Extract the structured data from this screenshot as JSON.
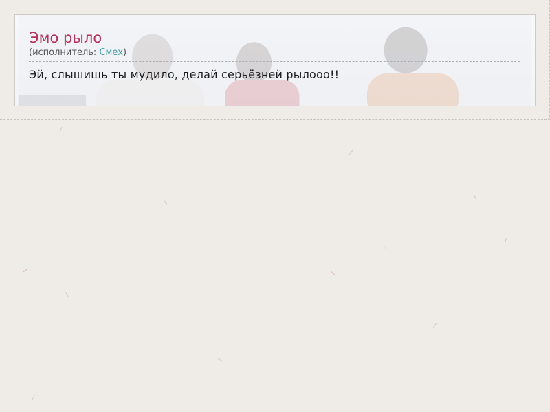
{
  "song": {
    "title": "Эмо рыло",
    "performer_prefix": "(исполнитель: ",
    "performer_name": "Смех",
    "performer_suffix": ")",
    "lyrics": "Эй, слышишь ты мудило, делай серьёзней рылооо!!"
  },
  "colors": {
    "title": "#b3345b",
    "link": "#3f9aa2",
    "background": "#efebe7"
  },
  "icons": {
    "background_photo": "band-photo"
  }
}
